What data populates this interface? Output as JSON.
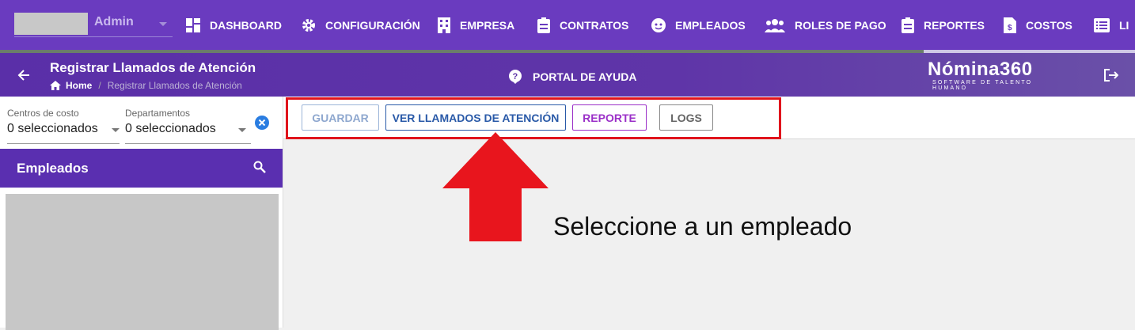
{
  "header": {
    "user_role": "Admin",
    "nav": [
      {
        "label": "DASHBOARD",
        "icon": "dashboard-icon"
      },
      {
        "label": "CONFIGURACIÓN",
        "icon": "gear-icon"
      },
      {
        "label": "EMPRESA",
        "icon": "building-icon"
      },
      {
        "label": "CONTRATOS",
        "icon": "clipboard-icon"
      },
      {
        "label": "EMPLEADOS",
        "icon": "face-icon"
      },
      {
        "label": "ROLES DE PAGO",
        "icon": "people-icon"
      },
      {
        "label": "REPORTES",
        "icon": "clipboard-icon"
      },
      {
        "label": "COSTOS",
        "icon": "file-dollar-icon"
      },
      {
        "label": "LI",
        "icon": "list-icon"
      }
    ]
  },
  "subheader": {
    "title": "Registrar Llamados de Atención",
    "breadcrumb_home": "Home",
    "breadcrumb_sep": "/",
    "breadcrumb_current": "Registrar Llamados de Atención",
    "help_label": "PORTAL DE AYUDA",
    "logo_title": "Nómina360",
    "logo_subtitle": "SOFTWARE DE TALENTO HUMANO"
  },
  "filters": {
    "cost_centers_label": "Centros de costo",
    "cost_centers_value": "0 seleccionados",
    "departments_label": "Departamentos",
    "departments_value": "0 seleccionados"
  },
  "employees": {
    "title": "Empleados"
  },
  "toolbar": {
    "save_label": "GUARDAR",
    "view_label": "VER LLAMADOS DE ATENCIÓN",
    "report_label": "REPORTE",
    "logs_label": "LOGS"
  },
  "main": {
    "empty_message": "Seleccione a un empleado"
  },
  "colors": {
    "header_purple": "#6a3bbf",
    "accent_red": "#e0141c",
    "report_purple": "#9b30c8",
    "view_blue": "#2a5aa8"
  }
}
